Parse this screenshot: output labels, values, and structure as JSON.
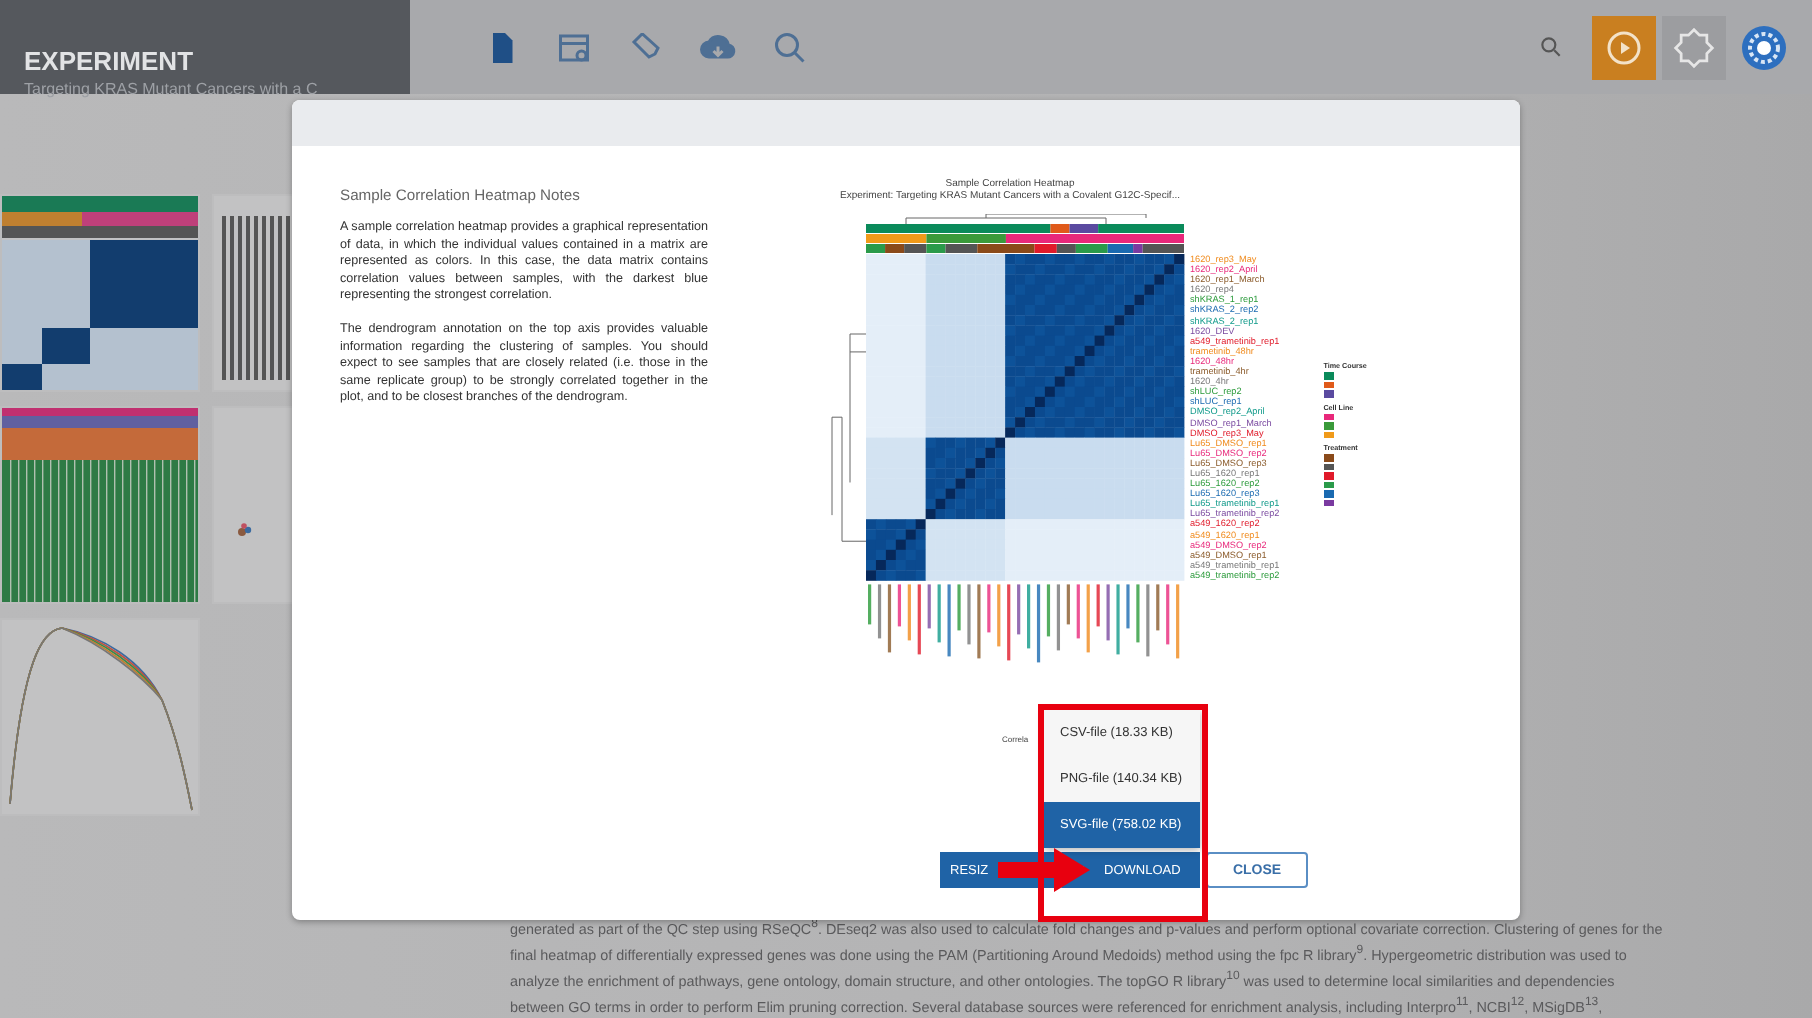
{
  "header": {
    "title": "EXPERIMENT",
    "subtitle": "Targeting KRAS Mutant Cancers with a C"
  },
  "background_text": [
    "generated as part of the QC step using RSeQC$^{8}$. DEseq2 was also used to calculate fold changes and p-values and perform optional covariate correction. Clustering of genes for the",
    "final heatmap of differentially expressed genes was done using the PAM (Partitioning Around Medoids) method using the fpc R library$^{9}$. Hypergeometric distribution was used to",
    "analyze the enrichment of pathways, gene ontology, domain structure, and other ontologies. The topGO R library$^{10}$ was used to determine local similarities and dependencies",
    "between GO terms in order to perform Elim pruning correction. Several database sources were referenced for enrichment analysis, including Interpro$^{11}$, NCBI$^{12}$, MSigDB$^{13}$,"
  ],
  "modal": {
    "notes_title": "Sample Correlation Heatmap Notes",
    "notes": [
      "A sample correlation heatmap provides a graphical representation of data, in which the individual values contained in a matrix are represented as colors. In this case, the data matrix contains correlation values between samples, with the darkest blue representing the strongest correlation.",
      "The dendrogram annotation on the top axis provides valuable information regarding the clustering of samples. You should expect to see samples that are closely related (i.e. those in the same replicate group) to be strongly correlated together in the plot, and to be closest branches of the dendrogram."
    ],
    "figure": {
      "title": "Sample Correlation Heatmap",
      "subtitle": "Experiment: Targeting KRAS Mutant Cancers with a Covalent G12C-Specif...",
      "axis_label": "Correla",
      "row_labels": [
        {
          "text": "1620_rep3_May"
        },
        {
          "text": "1620_rep2_April"
        },
        {
          "text": "1620_rep1_March"
        },
        {
          "text": "1620_rep4"
        },
        {
          "text": "shKRAS_1_rep1"
        },
        {
          "text": "shKRAS_2_rep2"
        },
        {
          "text": "shKRAS_2_rep1"
        },
        {
          "text": "1620_DEV"
        },
        {
          "text": "a549_trametinib_rep1"
        },
        {
          "text": "trametinib_48hr"
        },
        {
          "text": "1620_48hr"
        },
        {
          "text": "trametinib_4hr"
        },
        {
          "text": "1620_4hr"
        },
        {
          "text": "shLUC_rep2"
        },
        {
          "text": "shLUC_rep1"
        },
        {
          "text": "DMSO_rep2_April"
        },
        {
          "text": "DMSO_rep1_March"
        },
        {
          "text": "DMSO_rep3_May"
        },
        {
          "text": "Lu65_DMSO_rep1"
        },
        {
          "text": "Lu65_DMSO_rep2"
        },
        {
          "text": "Lu65_DMSO_rep3"
        },
        {
          "text": "Lu65_1620_rep1"
        },
        {
          "text": "Lu65_1620_rep2"
        },
        {
          "text": "Lu65_1620_rep3"
        },
        {
          "text": "Lu65_trametinib_rep1"
        },
        {
          "text": "Lu65_trametinib_rep2"
        },
        {
          "text": "a549_1620_rep2"
        },
        {
          "text": "a549_1620_rep1"
        },
        {
          "text": "a549_DMSO_rep2"
        },
        {
          "text": "a549_DMSO_rep1"
        },
        {
          "text": "a549_trametinib_rep1"
        },
        {
          "text": "a549_trametinib_rep2"
        }
      ],
      "legend": [
        {
          "title": "Time Course",
          "entries": [
            {
              "color": "#0a8a5a"
            },
            {
              "color": "#e05a1a"
            },
            {
              "color": "#5a4aa0"
            }
          ]
        },
        {
          "title": "Cell Line",
          "entries": [
            {
              "color": "#e8287a"
            },
            {
              "color": "#3a9a3a"
            },
            {
              "color": "#f09a1a"
            }
          ]
        },
        {
          "title": "Treatment",
          "entries": [
            {
              "color": "#8a4a1a"
            },
            {
              "color": "#555555"
            },
            {
              "color": "#e01a2a"
            },
            {
              "color": "#2a9a4a"
            },
            {
              "color": "#1a6ab0"
            },
            {
              "color": "#7a3aa0"
            }
          ]
        }
      ]
    },
    "download_menu": [
      {
        "label": "CSV-file (18.33 KB)",
        "selected": false
      },
      {
        "label": "PNG-file (140.34 KB)",
        "selected": false
      },
      {
        "label": "SVG-file (758.02 KB)",
        "selected": true
      }
    ],
    "buttons": {
      "resize": "RESIZ",
      "download": "DOWNLOAD",
      "close": "CLOSE"
    }
  }
}
